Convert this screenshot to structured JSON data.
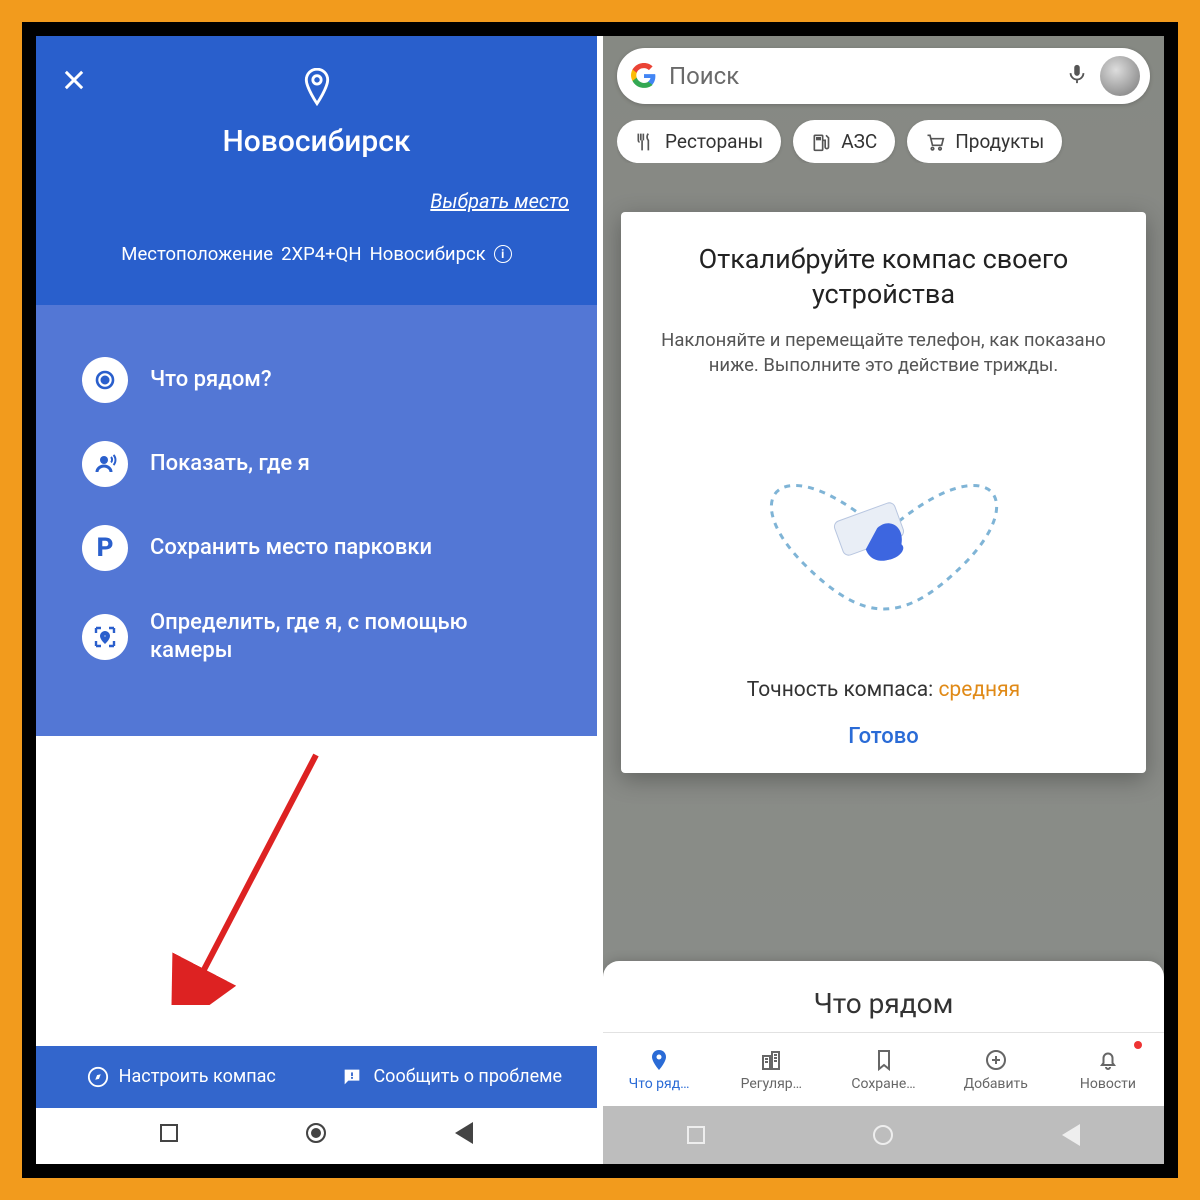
{
  "left": {
    "city": "Новосибирск",
    "choose_place": "Выбрать место",
    "location_prefix": "Местоположение",
    "plus_code": "2XP4+QH",
    "location_city": "Новосибирск",
    "actions": {
      "nearby": "Что рядом?",
      "share_loc": "Показать, где я",
      "save_parking": "Сохранить место парковки",
      "live_view": "Определить, где я, с помощью камеры"
    },
    "bottom": {
      "calibrate": "Настроить компас",
      "report": "Сообщить о проблеме"
    }
  },
  "right": {
    "search_placeholder": "Поиск",
    "chips": {
      "restaurants": "Рестораны",
      "gas": "АЗС",
      "groceries": "Продукты"
    },
    "dialog": {
      "title": "Откалибруйте компас своего устройства",
      "body": "Наклоняйте и перемещайте телефон, как показано ниже. Выполните это действие трижды.",
      "accuracy_label": "Точность компаса:",
      "accuracy_value": "средняя",
      "done": "Готово"
    },
    "nearby_title": "Что рядом",
    "nav": {
      "explore": "Что ряд…",
      "commute": "Регуляр…",
      "saved": "Сохране…",
      "contribute": "Добавить",
      "updates": "Новости"
    }
  }
}
